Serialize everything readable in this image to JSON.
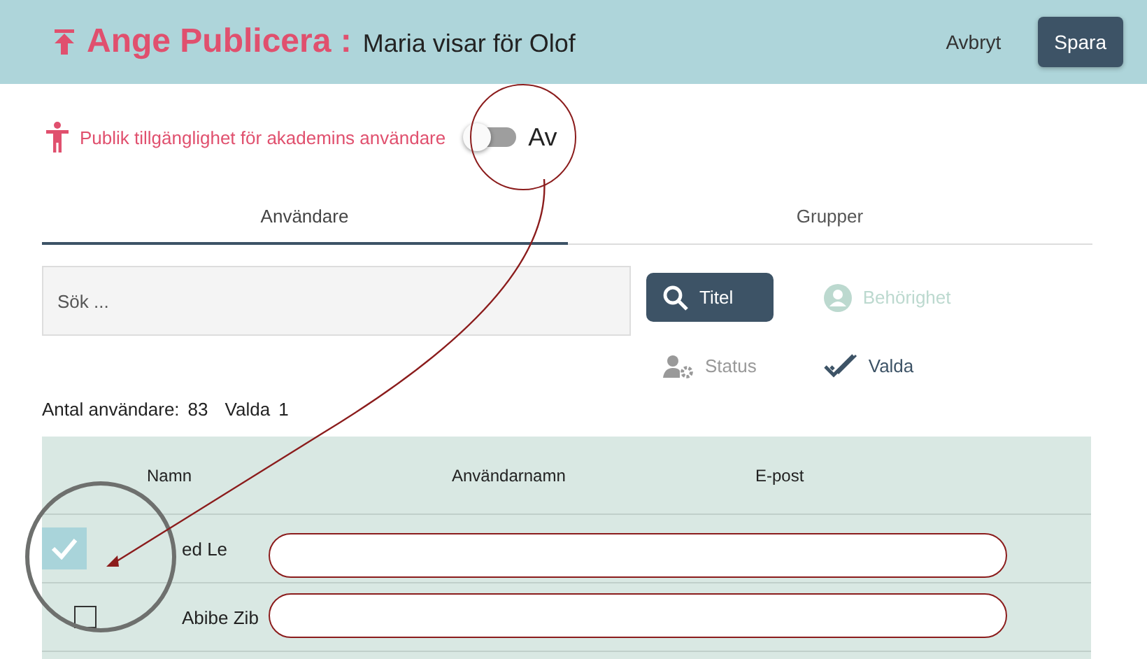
{
  "header": {
    "title": "Ange Publicera :",
    "subtitle": "Maria visar för Olof",
    "buttons": [
      {
        "label": "Avbryt",
        "kind": "text"
      },
      {
        "label": "Spara",
        "kind": "primary"
      }
    ]
  },
  "publish": {
    "label": "Publik tillgänglighet för akademins användare",
    "on": false,
    "state_label": "Av"
  },
  "tabs": [
    {
      "label": "Användare",
      "selected": true
    },
    {
      "label": "Grupper",
      "selected": false
    }
  ],
  "search": {
    "placeholder": "Sök ..."
  },
  "filters": [
    {
      "label": "Titel",
      "kind": "search",
      "selected": true
    },
    {
      "label": "Behörighet",
      "kind": "role",
      "selected": false
    },
    {
      "label": "Status",
      "kind": "status",
      "selected": false
    },
    {
      "label": "Valda",
      "kind": "chosen",
      "selected": true
    }
  ],
  "summary": {
    "count_label": "Antal användare:",
    "count": "83",
    "selected_label": "Valda",
    "selected_count": "1"
  },
  "table": {
    "columns": [
      "Namn",
      "Användarnamn",
      "E-post"
    ],
    "rows": [
      {
        "name": "ed Le",
        "checked": true
      },
      {
        "name": "Abibe Zib",
        "checked": false
      }
    ]
  }
}
